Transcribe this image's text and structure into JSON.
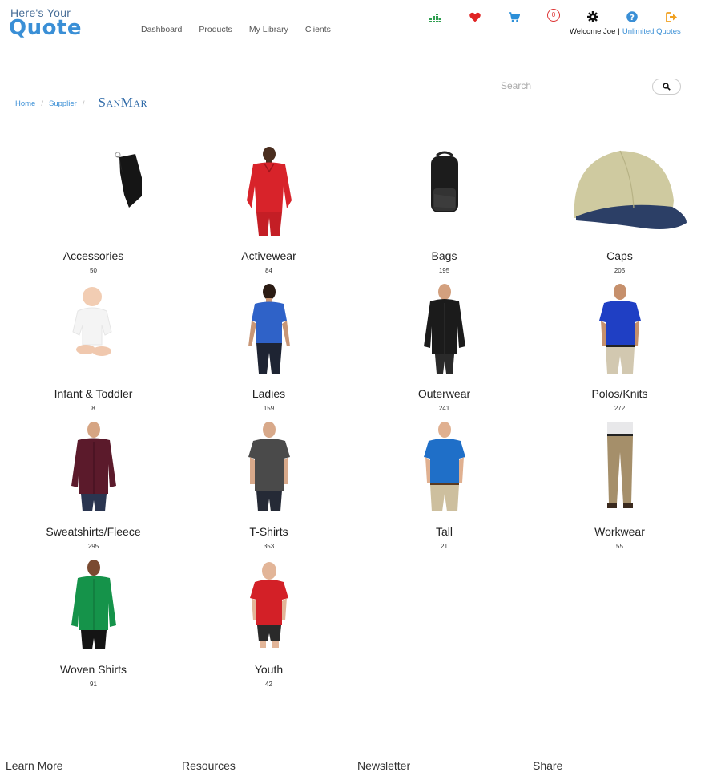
{
  "logo": {
    "line1": "Here's Your",
    "line2": "Quote"
  },
  "nav": [
    {
      "label": "Dashboard"
    },
    {
      "label": "Products"
    },
    {
      "label": "My Library"
    },
    {
      "label": "Clients"
    }
  ],
  "header": {
    "cart_count": "0",
    "welcome": "Welcome Joe",
    "separator": "|",
    "plan_link": "Unlimited Quotes"
  },
  "colors": {
    "brand_blue": "#3a8fd6",
    "stats_green": "#2e9e4f",
    "heart_red": "#e02424",
    "cart_blue": "#2b8fd8",
    "help_blue": "#3a8fd6",
    "logout_orange": "#f0a020"
  },
  "icons": [
    "stats-icon",
    "favorites-heart-icon",
    "cart-icon",
    "cart-count-badge",
    "settings-gear-icon",
    "help-icon",
    "logout-icon",
    "search-icon"
  ],
  "search": {
    "placeholder": "Search"
  },
  "breadcrumb": {
    "home": "Home",
    "supplier": "Supplier",
    "sep": "/",
    "brand": "SanMar"
  },
  "categories": [
    {
      "name": "Accessories",
      "count": "50"
    },
    {
      "name": "Activewear",
      "count": "84"
    },
    {
      "name": "Bags",
      "count": "195"
    },
    {
      "name": "Caps",
      "count": "205"
    },
    {
      "name": "Infant & Toddler",
      "count": "8"
    },
    {
      "name": "Ladies",
      "count": "159"
    },
    {
      "name": "Outerwear",
      "count": "241"
    },
    {
      "name": "Polos/Knits",
      "count": "272"
    },
    {
      "name": "Sweatshirts/Fleece",
      "count": "295"
    },
    {
      "name": "T-Shirts",
      "count": "353"
    },
    {
      "name": "Tall",
      "count": "21"
    },
    {
      "name": "Workwear",
      "count": "55"
    },
    {
      "name": "Woven Shirts",
      "count": "91"
    },
    {
      "name": "Youth",
      "count": "42"
    }
  ],
  "footer": {
    "learn_more": "Learn More",
    "resources": "Resources",
    "newsletter": "Newsletter",
    "share": "Share"
  }
}
